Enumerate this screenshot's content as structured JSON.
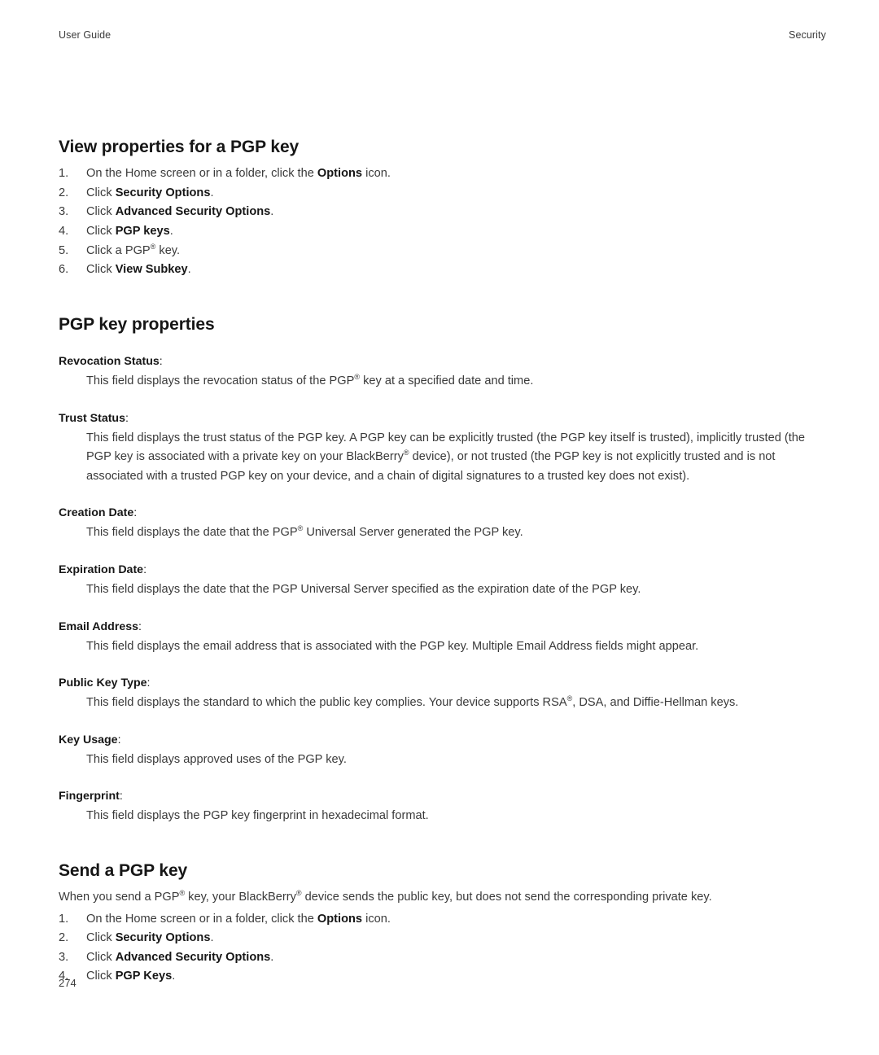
{
  "header": {
    "left": "User Guide",
    "right": "Security"
  },
  "page_number": "274",
  "sections": [
    {
      "id": "view-properties",
      "title": "View properties for a PGP key",
      "steps": [
        {
          "num": "1.",
          "pre": "On the Home screen or in a folder, click the ",
          "bold": "Options",
          "post": " icon."
        },
        {
          "num": "2.",
          "pre": "Click ",
          "bold": "Security Options",
          "post": "."
        },
        {
          "num": "3.",
          "pre": "Click ",
          "bold": "Advanced Security Options",
          "post": "."
        },
        {
          "num": "4.",
          "pre": "Click ",
          "bold": "PGP keys",
          "post": "."
        },
        {
          "num": "5.",
          "pre": "Click a PGP® key.",
          "bold": "",
          "post": ""
        },
        {
          "num": "6.",
          "pre": "Click ",
          "bold": "View Subkey",
          "post": "."
        }
      ]
    },
    {
      "id": "pgp-key-properties",
      "title": "PGP key properties",
      "definitions": [
        {
          "term": "Revocation Status",
          "desc": "This field displays the revocation status of the PGP® key at a specified date and time."
        },
        {
          "term": "Trust Status",
          "desc": "This field displays the trust status of the PGP key. A PGP key can be explicitly trusted (the PGP key itself is trusted), implicitly trusted (the PGP key is associated with a private key on your BlackBerry® device), or not trusted (the PGP key is not explicitly trusted and is not associated with a trusted PGP key on your device, and a chain of digital signatures to a trusted key does not exist)."
        },
        {
          "term": "Creation Date",
          "desc": "This field displays the date that the PGP® Universal Server generated the PGP key."
        },
        {
          "term": "Expiration Date",
          "desc": "This field displays the date that the PGP Universal Server specified as the expiration date of the PGP key."
        },
        {
          "term": "Email Address",
          "desc": "This field displays the email address that is associated with the PGP key. Multiple Email Address fields might appear."
        },
        {
          "term": "Public Key Type",
          "desc": "This field displays the standard to which the public key complies. Your device supports RSA®, DSA, and Diffie-Hellman keys."
        },
        {
          "term": "Key Usage",
          "desc": "This field displays approved uses of the PGP key."
        },
        {
          "term": "Fingerprint",
          "desc": "This field displays the PGP key fingerprint in hexadecimal format."
        }
      ]
    },
    {
      "id": "send-pgp-key",
      "title": "Send a PGP key",
      "intro": "When you send a PGP® key, your BlackBerry® device sends the public key, but does not send the corresponding private key.",
      "steps": [
        {
          "num": "1.",
          "pre": "On the Home screen or in a folder, click the ",
          "bold": "Options",
          "post": " icon."
        },
        {
          "num": "2.",
          "pre": "Click ",
          "bold": "Security Options",
          "post": "."
        },
        {
          "num": "3.",
          "pre": "Click ",
          "bold": "Advanced Security Options",
          "post": "."
        },
        {
          "num": "4.",
          "pre": "Click ",
          "bold": "PGP Keys",
          "post": "."
        }
      ]
    }
  ],
  "colors": {
    "heading": "#161616",
    "body": "#3a3a3a",
    "page_background": "#ffffff"
  }
}
